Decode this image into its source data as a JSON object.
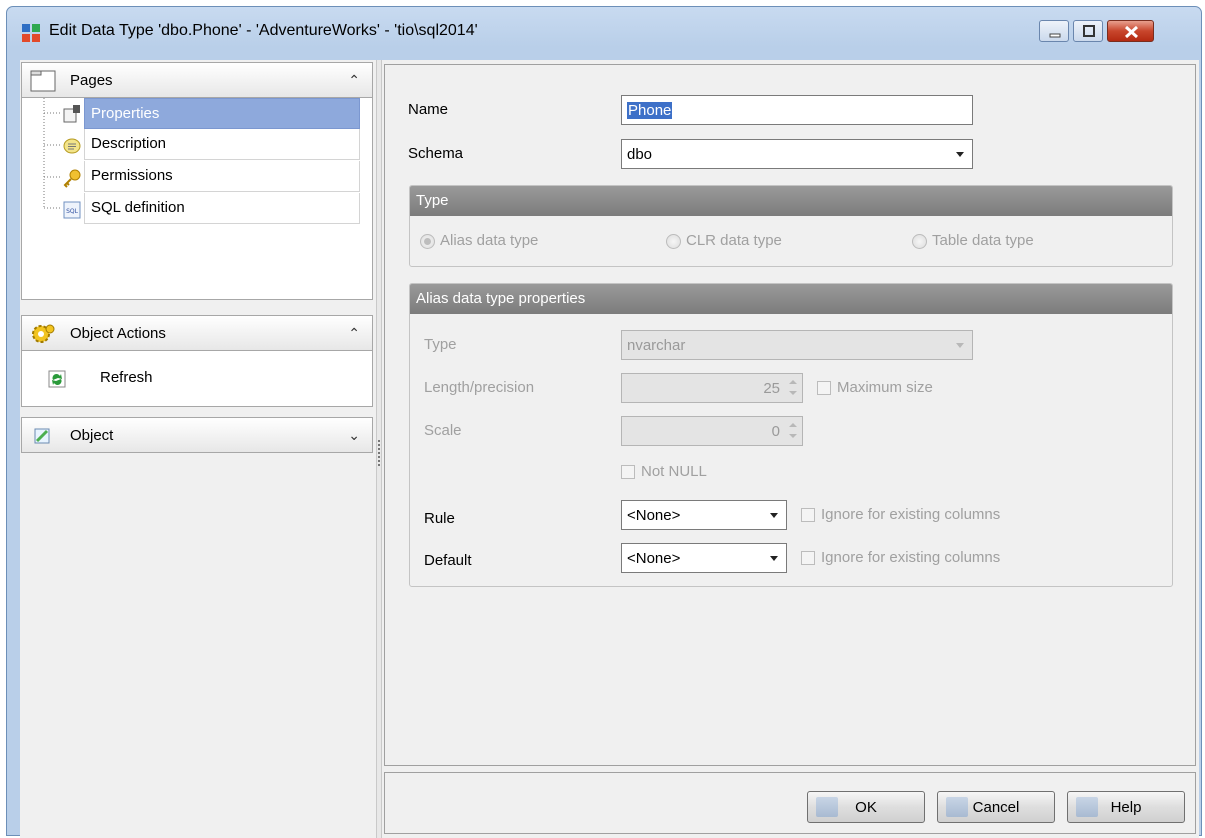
{
  "window": {
    "title": "Edit Data Type 'dbo.Phone' - 'AdventureWorks' - 'tio\\sql2014'"
  },
  "nav": {
    "pages_title": "Pages",
    "pages": [
      {
        "label": "Properties",
        "icon": "properties-icon",
        "selected": true
      },
      {
        "label": "Description",
        "icon": "description-icon",
        "selected": false
      },
      {
        "label": "Permissions",
        "icon": "key-icon",
        "selected": false
      },
      {
        "label": "SQL definition",
        "icon": "sql-icon",
        "selected": false
      }
    ],
    "actions_title": "Object Actions",
    "actions": [
      {
        "label": "Refresh",
        "icon": "refresh-icon"
      }
    ],
    "object_title": "Object"
  },
  "form": {
    "name_label": "Name",
    "name_value": "Phone",
    "schema_label": "Schema",
    "schema_value": "dbo",
    "type_section": "Type",
    "type_options": [
      {
        "label": "Alias data type",
        "checked": true
      },
      {
        "label": "CLR data type",
        "checked": false
      },
      {
        "label": "Table data type",
        "checked": false
      }
    ],
    "alias_section": "Alias data type properties",
    "type_label": "Type",
    "type_value": "nvarchar",
    "length_label": "Length/precision",
    "length_value": "25",
    "max_size_label": "Maximum size",
    "scale_label": "Scale",
    "scale_value": "0",
    "not_null_label": "Not NULL",
    "rule_label": "Rule",
    "rule_value": "<None>",
    "default_label": "Default",
    "default_value": "<None>",
    "ignore_label": "Ignore for existing columns"
  },
  "buttons": {
    "ok": "OK",
    "cancel": "Cancel",
    "help": "Help"
  },
  "colors": {
    "selection": "#8ea9dc",
    "section_header": "#8a8a8a",
    "close_button": "#c8462c"
  }
}
